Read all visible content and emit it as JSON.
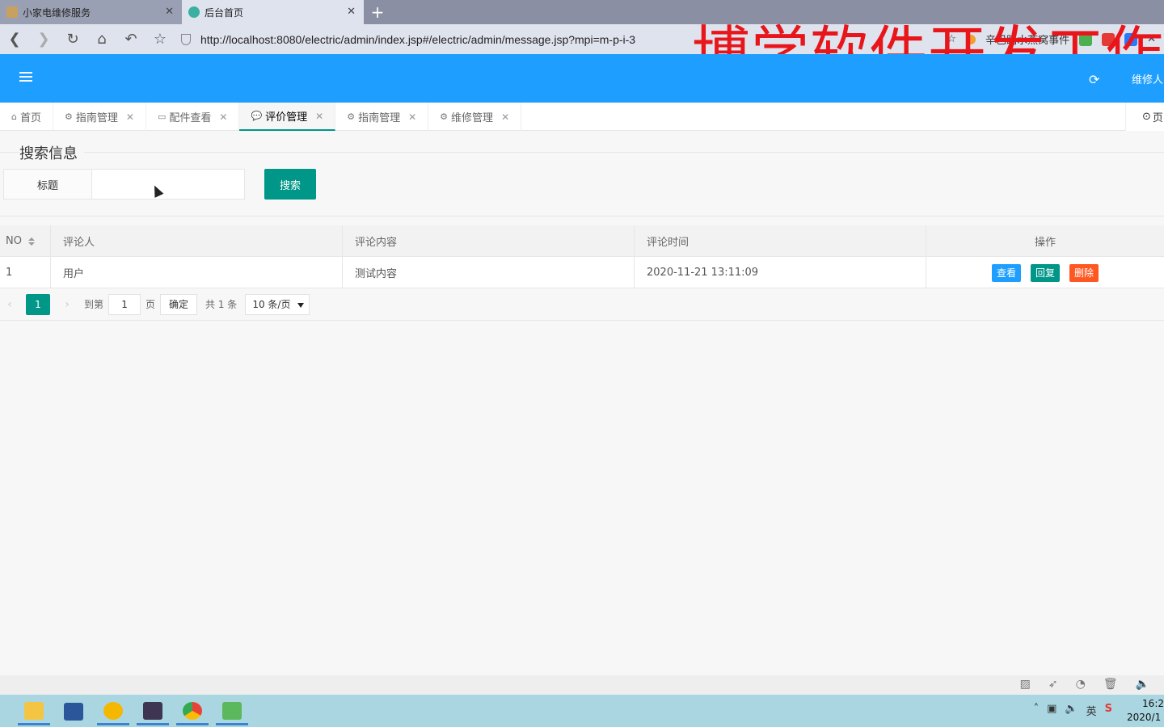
{
  "browser": {
    "tabs": [
      {
        "title": "小家电维修服务",
        "active": false
      },
      {
        "title": "后台首页",
        "active": true
      }
    ],
    "new_tab": "+",
    "url": "http://localhost:8080/electric/admin/index.jsp#/electric/admin/message.jsp?mpi=m-p-i-3",
    "extension_text": "辛巴踏水燕窝事件",
    "watermark": "博学软件开发工作"
  },
  "header": {
    "user": "维修人"
  },
  "page_tabs": [
    {
      "label": "首页",
      "icon": "home-icon",
      "closable": false,
      "active": false
    },
    {
      "label": "指南管理",
      "icon": "gears-icon",
      "closable": true,
      "active": false
    },
    {
      "label": "配件查看",
      "icon": "card-icon",
      "closable": true,
      "active": false
    },
    {
      "label": "评价管理",
      "icon": "comment-icon",
      "closable": true,
      "active": true
    },
    {
      "label": "指南管理",
      "icon": "gears-icon",
      "closable": true,
      "active": false
    },
    {
      "label": "维修管理",
      "icon": "cogs-icon",
      "closable": true,
      "active": false
    }
  ],
  "page_tabs_right": "页",
  "search": {
    "legend": "搜索信息",
    "field_label": "标题",
    "field_value": "",
    "button": "搜索"
  },
  "table": {
    "columns": [
      "NO",
      "评论人",
      "评论内容",
      "评论时间",
      "操作"
    ],
    "rows": [
      {
        "no": "1",
        "commenter": "用户",
        "content": "测试内容",
        "time": "2020-11-21 13:11:09"
      }
    ],
    "actions": {
      "view": "查看",
      "reply": "回复",
      "delete": "删除"
    }
  },
  "pager": {
    "current": "1",
    "goto_prefix": "到第",
    "goto_value": "1",
    "goto_suffix": "页",
    "confirm": "确定",
    "total": "共 1 条",
    "page_size": "10 条/页"
  },
  "taskbar": {
    "time": "16:2",
    "date": "2020/1"
  },
  "colors": {
    "header": "#1e9fff",
    "primary": "#009688",
    "view": "#1e9fff",
    "delete": "#ff5722",
    "watermark": "#e8161a"
  }
}
